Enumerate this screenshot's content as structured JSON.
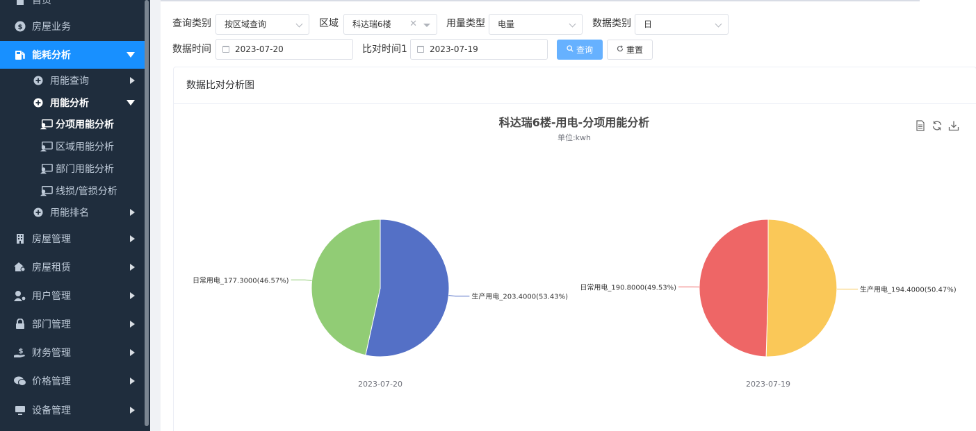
{
  "sidebar": {
    "items": [
      {
        "label": "首页",
        "icon": "home-icon"
      },
      {
        "label": "房屋业务",
        "icon": "dollar-circle-icon"
      },
      {
        "label": "能耗分析",
        "icon": "fuel-pump-icon",
        "active": true
      },
      {
        "label": "用能查询",
        "icon": "plus-circle-icon"
      },
      {
        "label": "用能分析",
        "icon": "plus-circle-icon"
      },
      {
        "label": "分项用能分析",
        "icon": "monitor-user-icon"
      },
      {
        "label": "区域用能分析",
        "icon": "monitor-user-icon"
      },
      {
        "label": "部门用能分析",
        "icon": "monitor-user-icon"
      },
      {
        "label": "线损/管损分析",
        "icon": "monitor-user-icon"
      },
      {
        "label": "用能排名",
        "icon": "plus-circle-icon"
      },
      {
        "label": "房屋管理",
        "icon": "building-icon"
      },
      {
        "label": "房屋租赁",
        "icon": "house-key-icon"
      },
      {
        "label": "用户管理",
        "icon": "user-gear-icon"
      },
      {
        "label": "部门管理",
        "icon": "lock-icon"
      },
      {
        "label": "财务管理",
        "icon": "hand-money-icon"
      },
      {
        "label": "价格管理",
        "icon": "chat-price-icon"
      },
      {
        "label": "设备管理",
        "icon": "desktop-icon"
      }
    ]
  },
  "filters": {
    "query_type_label": "查询类别",
    "query_type_value": "按区域查询",
    "area_label": "区域",
    "area_value": "科达瑞6楼",
    "usage_type_label": "用量类型",
    "usage_type_value": "电量",
    "data_type_label": "数据类别",
    "data_type_value": "日",
    "data_time_label": "数据时间",
    "data_time_value": "2023-07-20",
    "compare_time_label": "比对时间1",
    "compare_time_value": "2023-07-19",
    "search_button": "查询",
    "reset_button": "重置"
  },
  "card": {
    "title": "数据比对分析图"
  },
  "colors": {
    "primary": "#1890ff",
    "blue": "#5470c6",
    "green": "#91cc75",
    "red": "#ee6666",
    "yellow": "#fac858"
  },
  "chart_data": {
    "type": "pie",
    "title": "科达瑞6楼-用电-分项用能分析",
    "subtitle": "单位:kwh",
    "pies": [
      {
        "caption": "2023-07-20",
        "slices": [
          {
            "name": "生产用电",
            "value": 203.4,
            "percent": 53.43,
            "label": "生产用电_203.4000(53.43%)",
            "color": "#5470c6"
          },
          {
            "name": "日常用电",
            "value": 177.3,
            "percent": 46.57,
            "label": "日常用电_177.3000(46.57%)",
            "color": "#91cc75"
          }
        ]
      },
      {
        "caption": "2023-07-19",
        "slices": [
          {
            "name": "生产用电",
            "value": 194.4,
            "percent": 50.47,
            "label": "生产用电_194.4000(50.47%)",
            "color": "#fac858"
          },
          {
            "name": "日常用电",
            "value": 190.8,
            "percent": 49.53,
            "label": "日常用电_190.8000(49.53%)",
            "color": "#ee6666"
          }
        ]
      }
    ]
  }
}
